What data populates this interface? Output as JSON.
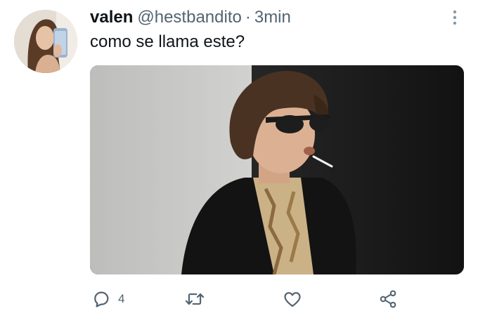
{
  "tweet": {
    "author": {
      "display_name": "valen",
      "handle": "@hestbandito",
      "separator": "·",
      "time": "3min",
      "avatar_icon": "profile-photo"
    },
    "text": "como se llama este?",
    "media": {
      "description_icon": "photo",
      "colors": {
        "background_light": "#c9c9c7",
        "background_dark": "#1a1a1a",
        "hair": "#4a3222",
        "jacket": "#141414",
        "shirt": "#cdb58a"
      }
    },
    "actions": {
      "reply": {
        "icon": "reply-icon",
        "count": "4"
      },
      "retweet": {
        "icon": "retweet-icon"
      },
      "like": {
        "icon": "heart-icon"
      },
      "share": {
        "icon": "share-icon"
      }
    },
    "colors": {
      "text_primary": "#0f1419",
      "text_secondary": "#536471"
    }
  }
}
